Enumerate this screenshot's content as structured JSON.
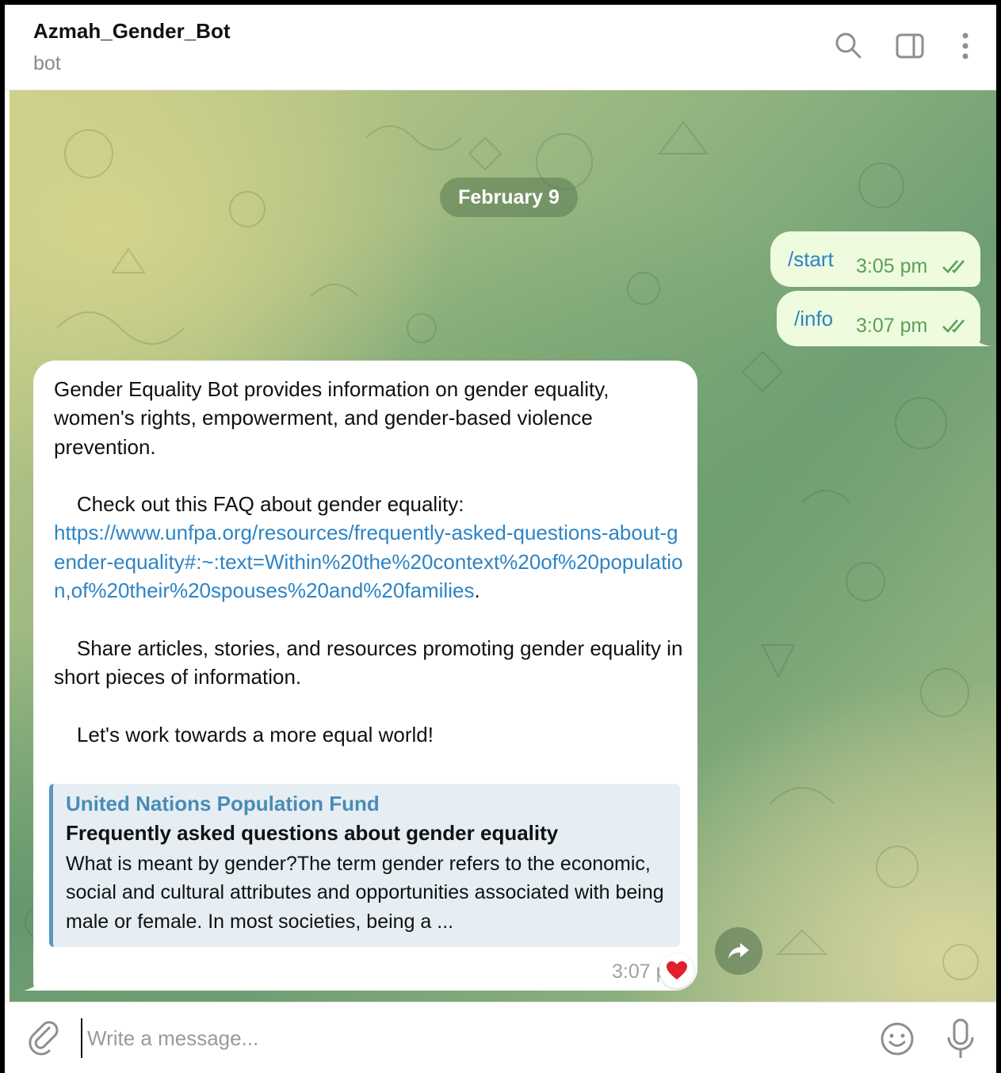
{
  "header": {
    "title": "Azmah_Gender_Bot",
    "subtitle": "bot",
    "icons": [
      "search-icon",
      "sidebar-toggle-icon",
      "more-vertical-icon"
    ]
  },
  "chat": {
    "date_divider": "February 9",
    "outgoing": [
      {
        "text": "/start",
        "time": "3:05 pm",
        "status": "read"
      },
      {
        "text": "/info",
        "time": "3:07 pm",
        "status": "read"
      }
    ],
    "incoming": {
      "intro": "Gender Equality Bot provides information on gender equality, women's rights, empowerment, and gender-based violence prevention.",
      "faq_prompt": "    Check out this FAQ about gender equality:",
      "link": "https://www.unfpa.org/resources/frequently-asked-questions-about-gender-equality#:~:text=Within%20the%20context%20of%20population,of%20their%20spouses%20and%20families",
      "link_suffix": ".",
      "share_text": "    Share articles, stories, and resources promoting gender equality in short pieces of information.",
      "closing": "    Let's work towards a more equal world!",
      "preview": {
        "site": "United Nations Population Fund",
        "title": "Frequently asked questions about gender equality",
        "description": "What is meant by gender?The term gender refers to the economic, social and cultural attributes and opportunities associated with being male or female. In most societies, being a ..."
      },
      "time": "3:07 pm",
      "reaction": "heart-icon"
    },
    "forward_icon": "forward-arrow-icon",
    "colors": {
      "outgoing_bubble": "#eefbdf",
      "link": "#2e84c4",
      "preview_accent": "#5897c0",
      "reaction_heart": "#e0202a"
    }
  },
  "composer": {
    "placeholder": "Write a message...",
    "icons": [
      "paperclip-icon",
      "emoji-icon",
      "microphone-icon"
    ]
  }
}
